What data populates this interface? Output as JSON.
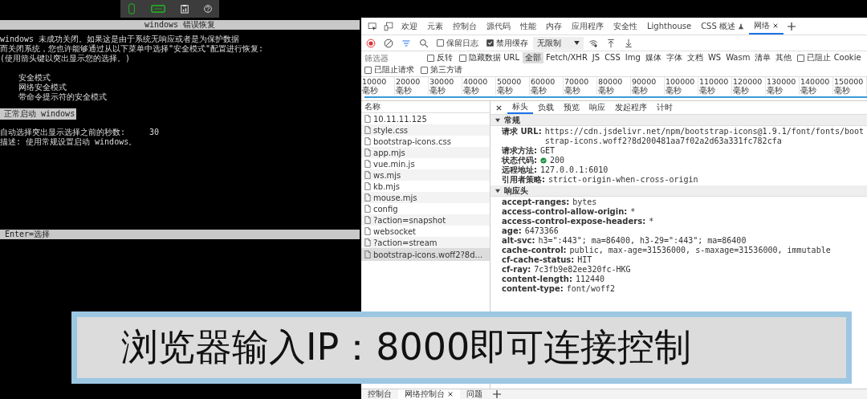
{
  "console": {
    "title": "windows 错误恢复",
    "message_lines": [
      "windows 未成功关闭。如果这是由于系统无响应或者是为保护数据",
      "而关闭系统，您也许能够通过从以下菜单中选择\"安全模式\"配置进行恢复:",
      "(使用箭头键以突出显示您的选择。)"
    ],
    "options": [
      {
        "label": "安全模式",
        "selected": false
      },
      {
        "label": "网络安全模式",
        "selected": false
      },
      {
        "label": "带命令提示符的安全模式",
        "selected": false
      },
      {
        "label": "正常启动 windows",
        "selected": true
      }
    ],
    "countdown_label": "自动选择突出显示选择之前的秒数:",
    "countdown_value": "30",
    "description": "描述: 使用常规设置启动 windows。",
    "footer": "Enter=选择"
  },
  "devtools": {
    "tabs": [
      {
        "label": "欢迎",
        "selected": false,
        "closable": false
      },
      {
        "label": "元素",
        "selected": false,
        "closable": false
      },
      {
        "label": "控制台",
        "selected": false,
        "closable": false
      },
      {
        "label": "源代码",
        "selected": false,
        "closable": false
      },
      {
        "label": "性能",
        "selected": false,
        "closable": false
      },
      {
        "label": "内存",
        "selected": false,
        "closable": false
      },
      {
        "label": "应用程序",
        "selected": false,
        "closable": false
      },
      {
        "label": "安全性",
        "selected": false,
        "closable": false
      },
      {
        "label": "Lighthouse",
        "selected": false,
        "closable": false
      },
      {
        "label": "CSS 概述",
        "selected": false,
        "closable": false,
        "experimental": true
      },
      {
        "label": "网络",
        "selected": true,
        "closable": true
      }
    ],
    "toolbar": {
      "checkboxes": [
        {
          "label": "保留日志",
          "checked": false
        },
        {
          "label": "禁用缓存",
          "checked": true
        }
      ],
      "throttling": "无限制"
    },
    "filter": {
      "placeholder": "筛选器",
      "checkboxes": [
        {
          "label": "反转",
          "checked": false
        },
        {
          "label": "隐藏数据 URL",
          "checked": false
        }
      ],
      "types": [
        {
          "label": "全部",
          "selected": true
        },
        {
          "label": "Fetch/XHR",
          "selected": false
        },
        {
          "label": "JS",
          "selected": false
        },
        {
          "label": "CSS",
          "selected": false
        },
        {
          "label": "Img",
          "selected": false
        },
        {
          "label": "媒体",
          "selected": false
        },
        {
          "label": "字体",
          "selected": false
        },
        {
          "label": "文档",
          "selected": false
        },
        {
          "label": "WS",
          "selected": false
        },
        {
          "label": "Wasm",
          "selected": false
        },
        {
          "label": "清单",
          "selected": false
        },
        {
          "label": "其他",
          "selected": false
        }
      ],
      "blocked": [
        {
          "label": "已阻止 Cookie",
          "checked": false
        },
        {
          "label": "已阻止请求",
          "checked": false
        },
        {
          "label": "第三方请",
          "checked": false
        }
      ]
    },
    "timeline_ticks": [
      "10000 毫秒",
      "20000 毫秒",
      "30000 毫秒",
      "40000 毫秒",
      "50000 毫秒",
      "60000 毫秒",
      "70000 毫秒",
      "80000 毫秒",
      "90000 毫秒",
      "100000 毫秒",
      "110000 毫秒",
      "120000 毫秒",
      "130000 毫秒",
      "140000 毫秒",
      "150000 毫秒"
    ],
    "requests_header": "名称",
    "requests": [
      {
        "name": "10.11.11.125",
        "selected": false
      },
      {
        "name": "style.css",
        "selected": false
      },
      {
        "name": "bootstrap-icons.css",
        "selected": false
      },
      {
        "name": "app.mjs",
        "selected": false
      },
      {
        "name": "vue.min.js",
        "selected": false
      },
      {
        "name": "ws.mjs",
        "selected": false
      },
      {
        "name": "kb.mjs",
        "selected": false
      },
      {
        "name": "mouse.mjs",
        "selected": false
      },
      {
        "name": "config",
        "selected": false
      },
      {
        "name": "?action=snapshot",
        "selected": false
      },
      {
        "name": "websocket",
        "selected": false
      },
      {
        "name": "?action=stream",
        "selected": false
      },
      {
        "name": "bootstrap-icons.woff2?8d...",
        "selected": true
      }
    ],
    "detail_tabs": [
      {
        "label": "标头",
        "selected": true
      },
      {
        "label": "负载",
        "selected": false
      },
      {
        "label": "预览",
        "selected": false
      },
      {
        "label": "响应",
        "selected": false
      },
      {
        "label": "发起程序",
        "selected": false
      },
      {
        "label": "计时",
        "selected": false
      }
    ],
    "sections": [
      {
        "title": "常规",
        "expanded": true,
        "rows": [
          {
            "kind": "text",
            "name": "请求 URL:",
            "value": "https://cdn.jsdelivr.net/npm/bootstrap-icons@1.9.1/font/fonts/bootstrap-icons.woff2?8d200481aa7f02a2d63a331fc782cfa"
          },
          {
            "kind": "text",
            "name": "请求方法:",
            "value": "GET"
          },
          {
            "kind": "status",
            "name": "状态代码:",
            "value": "200"
          },
          {
            "kind": "text",
            "name": "远程地址:",
            "value": "127.0.0.1:6010"
          },
          {
            "kind": "text",
            "name": "引用者策略:",
            "value": "strict-origin-when-cross-origin"
          }
        ]
      },
      {
        "title": "响应头",
        "expanded": true,
        "rows": [
          {
            "kind": "text",
            "name": "accept-ranges:",
            "value": "bytes"
          },
          {
            "kind": "text",
            "name": "access-control-allow-origin:",
            "value": "*"
          },
          {
            "kind": "text",
            "name": "access-control-expose-headers:",
            "value": "*"
          },
          {
            "kind": "text",
            "name": "age:",
            "value": "6473366"
          },
          {
            "kind": "text",
            "name": "alt-svc:",
            "value": "h3=\":443\"; ma=86400, h3-29=\":443\"; ma=86400"
          },
          {
            "kind": "text",
            "name": "cache-control:",
            "value": "public, max-age=31536000, s-maxage=31536000, immutable"
          },
          {
            "kind": "text",
            "name": "cf-cache-status:",
            "value": "HIT"
          },
          {
            "kind": "text",
            "name": "cf-ray:",
            "value": "7c3fb9e82ee320fc-HKG"
          },
          {
            "kind": "text",
            "name": "content-length:",
            "value": "112440"
          },
          {
            "kind": "text",
            "name": "content-type:",
            "value": "font/woff2"
          }
        ]
      }
    ],
    "drawer_tabs": [
      {
        "label": "控制台",
        "selected": false,
        "closable": false
      },
      {
        "label": "网络控制台",
        "selected": true,
        "closable": true
      },
      {
        "label": "问题",
        "selected": false,
        "closable": false
      }
    ]
  },
  "caption": "浏览器输入IP：8000即可连接控制"
}
